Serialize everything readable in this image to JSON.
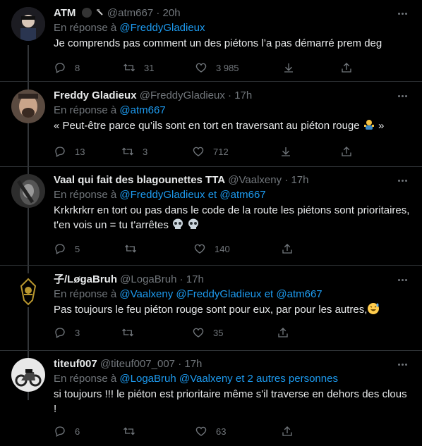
{
  "tweets": [
    {
      "name": "ATM",
      "handle": "@atm667",
      "time": "20h",
      "reply_prefix": "En réponse à",
      "mentions": [
        "@FreddyGladieux"
      ],
      "text": "Je comprends pas comment un des piétons l’a pas démarré prem deg",
      "replies": "8",
      "retweets": "31",
      "likes": "3 985"
    },
    {
      "name": "Freddy Gladieux",
      "handle": "@FreddyGladieux",
      "time": "17h",
      "reply_prefix": "En réponse à",
      "mentions": [
        "@atm667"
      ],
      "text": "« Peut-être parce qu’ils sont en tort en traversant au piéton rouge",
      "text_end": "»",
      "replies": "13",
      "retweets": "3",
      "likes": "712"
    },
    {
      "name": "Vaal qui fait des blagounettes TTA",
      "handle": "@Vaalxeny",
      "time": "17h",
      "reply_prefix": "En réponse à",
      "mentions": [
        "@FreddyGladieux",
        "et",
        "@atm667"
      ],
      "text": "Krkrkrkrr en tort ou pas dans le code de la route les piétons sont prioritaires, t'en vois un = tu t'arrêtes",
      "replies": "5",
      "retweets": "",
      "likes": "140"
    },
    {
      "name": "子/LøgaBruh",
      "handle": "@LogaBruh",
      "time": "17h",
      "reply_prefix": "En réponse à",
      "mentions": [
        "@Vaalxeny",
        "@FreddyGladieux",
        "et",
        "@atm667"
      ],
      "text": "Pas toujours le feu piéton rouge sont pour eux, par pour les autres,",
      "replies": "3",
      "retweets": "",
      "likes": "35"
    },
    {
      "name": "titeuf007",
      "handle": "@titeuf007_007",
      "time": "17h",
      "reply_prefix": "En réponse à",
      "mentions": [
        "@LogaBruh",
        "@Vaalxeny",
        "et",
        "2 autres personnes"
      ],
      "text": "si toujours !!! le piéton est prioritaire même s'il traverse en dehors des clous !",
      "replies": "6",
      "retweets": "",
      "likes": "63"
    }
  ],
  "separator": "·",
  "colors": {
    "accent": "#1d9bf0",
    "muted": "#71767b",
    "text": "#e7e9ea",
    "background": "#000000"
  }
}
